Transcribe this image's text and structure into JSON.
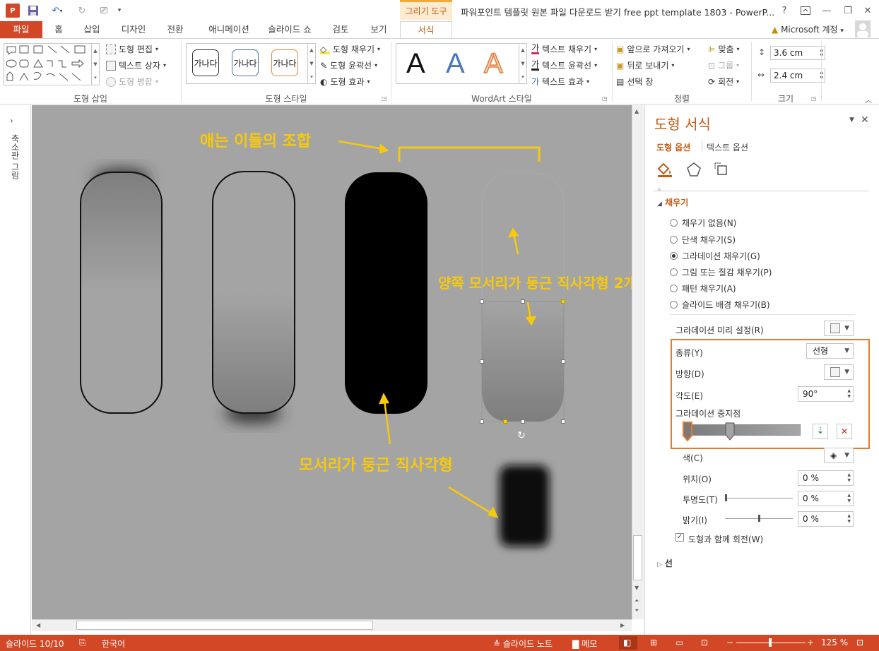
{
  "app": {
    "icon_letter": "P",
    "context_group": "그리기 도구",
    "window_title": "파워포인트 템플릿 원본 파일 다운로드 받기 free ppt template 1803 - PowerP...",
    "help": "?",
    "account": "Microsoft 계정"
  },
  "tabs": [
    "파일",
    "홈",
    "삽입",
    "디자인",
    "전환",
    "애니메이션",
    "슬라이드 쇼",
    "검토",
    "보기",
    "서식"
  ],
  "ribbon": {
    "shape_insert": {
      "label": "도형 삽입",
      "edit_shape": "도형 편집",
      "text_box": "텍스트 상자",
      "merge_shapes": "도형 병합"
    },
    "shape_styles": {
      "label": "도형 스타일",
      "swatch_text": "가나다",
      "fill": "도형 채우기",
      "outline": "도형 윤곽선",
      "effects": "도형 효과"
    },
    "wordart": {
      "label": "WordArt 스타일",
      "letter": "A",
      "text_fill": "텍스트 채우기",
      "text_outline": "텍스트 윤곽선",
      "text_effects": "텍스트 효과"
    },
    "arrange": {
      "label": "정렬",
      "bring_forward": "앞으로 가져오기",
      "send_backward": "뒤로 보내기",
      "selection_pane": "선택 창",
      "align": "맞춤",
      "group": "그룹",
      "rotate": "회전"
    },
    "size": {
      "label": "크기",
      "height": "3.6 cm",
      "width": "2.4 cm"
    }
  },
  "thumbnails_label": "축소판 그림",
  "canvas": {
    "callout_combo": "애는 이들의 조합",
    "callout_both": "양쪽 모서리가 둥근 직사각형 2개",
    "callout_rounded": "모서리가 둥근 직사각형"
  },
  "format_pane": {
    "title": "도형 서식",
    "tab_shape": "도형 옵션",
    "tab_text": "텍스트 옵션",
    "fill_section": "채우기",
    "fill_options": [
      {
        "label": "채우기 없음(N)",
        "selected": false
      },
      {
        "label": "단색 채우기(S)",
        "selected": false
      },
      {
        "label": "그라데이션 채우기(G)",
        "selected": true
      },
      {
        "label": "그림 또는 질감 채우기(P)",
        "selected": false
      },
      {
        "label": "패턴 채우기(A)",
        "selected": false
      },
      {
        "label": "슬라이드 배경 채우기(B)",
        "selected": false
      }
    ],
    "preset_label": "그라데이션 미리 설정(R)",
    "type_label": "종류(Y)",
    "type_value": "선형",
    "direction_label": "방향(D)",
    "angle_label": "각도(E)",
    "angle_value": "90°",
    "stops_label": "그라데이션 중지점",
    "color_label": "색(C)",
    "position_label": "위치(O)",
    "position_value": "0 %",
    "transparency_label": "투명도(T)",
    "transparency_value": "0 %",
    "brightness_label": "밝기(I)",
    "brightness_value": "0 %",
    "rotate_with_shape": "도형과 함께 회전(W)",
    "line_section": "선"
  },
  "status": {
    "slide": "슬라이드 10/10",
    "language": "한국어",
    "notes": "슬라이드 노트",
    "comments": "메모",
    "zoom": "125 %"
  },
  "colors": {
    "accent": "#d24726",
    "highlight": "#e8782d",
    "callout": "#f7c90d",
    "canvas": "#a4a4a4"
  }
}
